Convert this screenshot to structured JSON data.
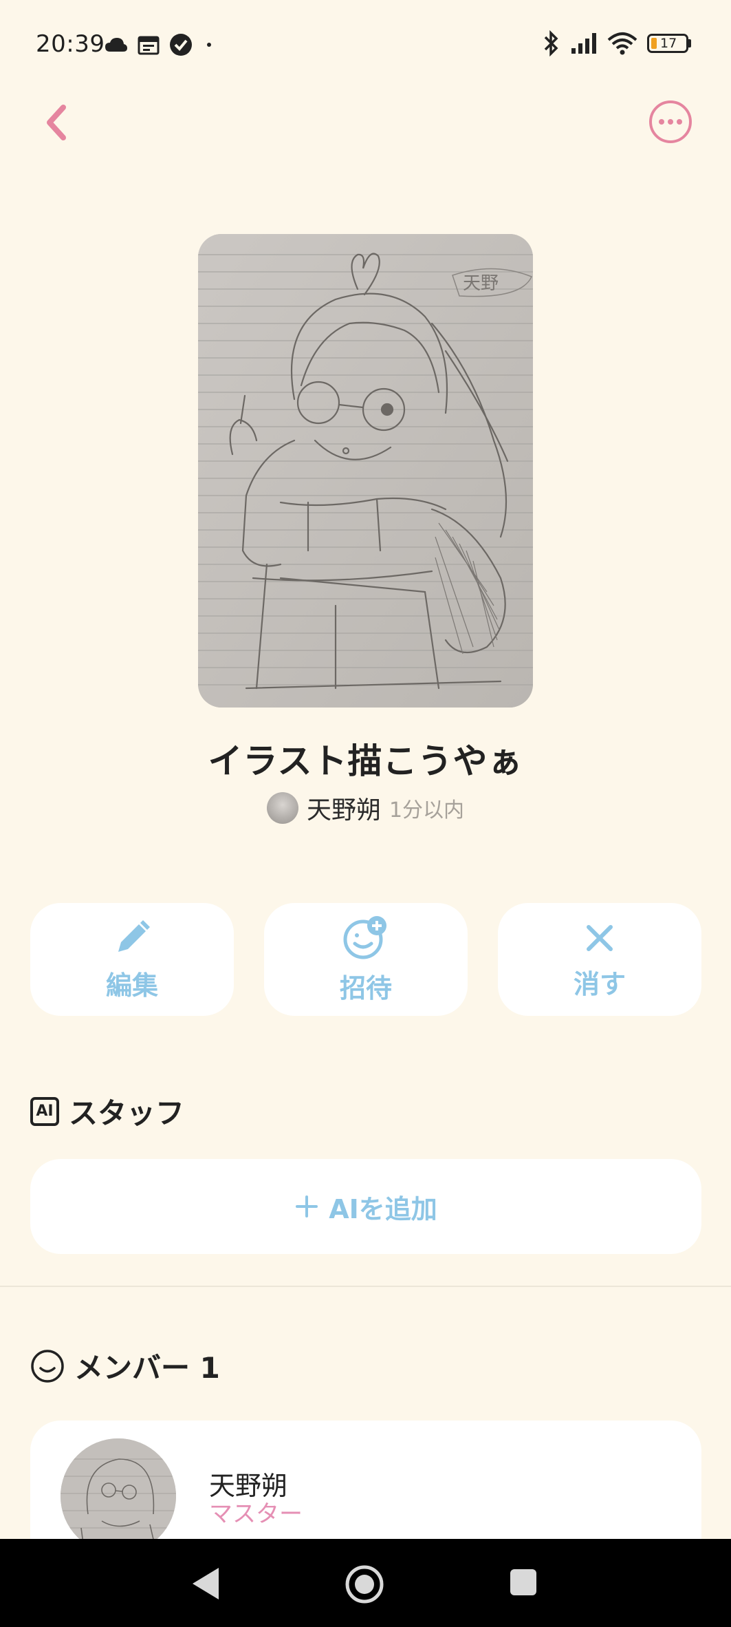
{
  "status_bar": {
    "time": "20:39",
    "battery": "17",
    "left_icons": [
      "cloud-icon",
      "calendar-icon",
      "check-circle-icon",
      "dot-icon"
    ],
    "right_icons": [
      "bluetooth-icon",
      "signal-icon",
      "wifi-icon",
      "battery-icon"
    ]
  },
  "header": {
    "back_icon": "chevron-left-icon",
    "more_icon": "more-horizontal-icon"
  },
  "room": {
    "title": "イラスト描こうやぁ",
    "owner_name": "天野朔",
    "updated": "1分以内"
  },
  "actions": [
    {
      "label": "編集",
      "icon": "pencil-icon"
    },
    {
      "label": "招待",
      "icon": "add-person-icon"
    },
    {
      "label": "消す",
      "icon": "close-icon"
    }
  ],
  "staff": {
    "heading": "スタッフ",
    "badge": "AI",
    "add_label": "AIを追加"
  },
  "members": {
    "heading": "メンバー 1",
    "list": [
      {
        "name": "天野朔",
        "role": "マスター"
      }
    ]
  },
  "colors": {
    "background": "#fdf7ea",
    "accent_pink": "#e5859f",
    "accent_blue": "#8ec6e6",
    "role_pink": "#e58fb4"
  }
}
